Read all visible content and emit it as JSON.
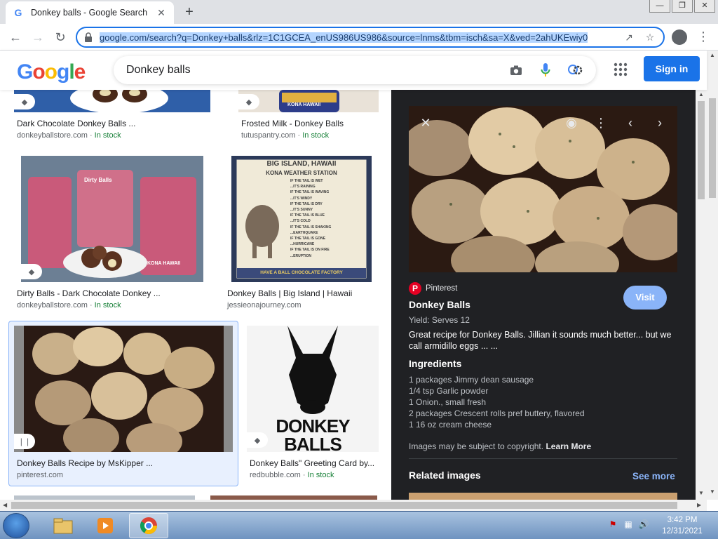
{
  "browser": {
    "tab_title": "Donkey balls - Google Search",
    "tab_close": "✕",
    "new_tab": "+",
    "url_prefix": "google.com/search?q=Donkey+balls&rlz=1C1GCEA_enUS986US986&source=lnms&tbm=isch&sa=X&ved=2ahUKEwiy0",
    "window_controls": [
      "—",
      "❐",
      "✕"
    ]
  },
  "google": {
    "logo_letters": [
      "G",
      "o",
      "o",
      "g",
      "l",
      "e"
    ],
    "query": "Donkey balls",
    "signin_label": "Sign in"
  },
  "results": [
    {
      "title": "Dark Chocolate Donkey Balls ...",
      "source": "donkeyballstore.com",
      "stock": "In stock"
    },
    {
      "title": "Frosted Milk - Donkey Balls",
      "source": "tutuspantry.com",
      "stock": "In stock"
    },
    {
      "title": "Dirty Balls - Dark Chocolate Donkey ...",
      "source": "donkeyballstore.com",
      "stock": "In stock"
    },
    {
      "title": "Donkey Balls | Big Island | Hawaii",
      "source": "jessieonajourney.com",
      "stock": ""
    },
    {
      "title": "Donkey Balls Recipe by MsKipper ...",
      "source": "pinterest.com",
      "stock": ""
    },
    {
      "title": "Donkey Balls\" Greeting Card by...",
      "source": "redbubble.com",
      "stock": "In stock"
    }
  ],
  "thumb_text": {
    "kona_hawaii": "KONA HAWAII",
    "dirty_balls": "Dirty Balls",
    "kona_hawaii_2": "KONA HAWAII",
    "big_island": "BIG ISLAND, HAWAII",
    "kona_weather": "KONA WEATHER STATION",
    "weather_lines": [
      "IF THE TAIL IS WET",
      "...IT'S RAINING",
      "IF THE TAIL IS WAVING",
      "...IT'S WINDY",
      "IF THE TAIL IS DRY",
      "...IT'S SUNNY",
      "IF THE TAIL IS BLUE",
      "...IT'S COLD",
      "IF THE TAIL IS SHAKING",
      "...EARTHQUAKE",
      "IF THE TAIL IS GONE",
      "...HURRICANE",
      "IF THE TAIL IS ON FIRE",
      "...ERUPTION"
    ],
    "chocolate_factory": "HAVE A BALL CHOCOLATE FACTORY",
    "donkey": "DONKEY",
    "balls": "BALLS"
  },
  "panel": {
    "source_name": "Pinterest",
    "title": "Donkey Balls",
    "visit_label": "Visit",
    "yield": "Yield: Serves 12",
    "description": "Great recipe for Donkey Balls. Jillian it sounds much better... but we call armidillo eggs ... ...",
    "ingredients_heading": "Ingredients",
    "ingredients": [
      "1 packages Jimmy dean sausage",
      "1/4 tsp Garlic powder",
      "1 Onion., small fresh",
      "2 packages Crescent rolls pref buttery, flavored",
      "1 16 oz cream cheese"
    ],
    "copyright_text": "Images may be subject to copyright.",
    "learn_more": "Learn More",
    "related_heading": "Related images",
    "see_more": "See more"
  },
  "taskbar": {
    "time": "3:42 PM",
    "date": "12/31/2021"
  },
  "colors": {
    "accent": "#1a73e8",
    "panel_bg": "#202124",
    "visit_button": "#8ab4f8",
    "in_stock": "#188038"
  }
}
